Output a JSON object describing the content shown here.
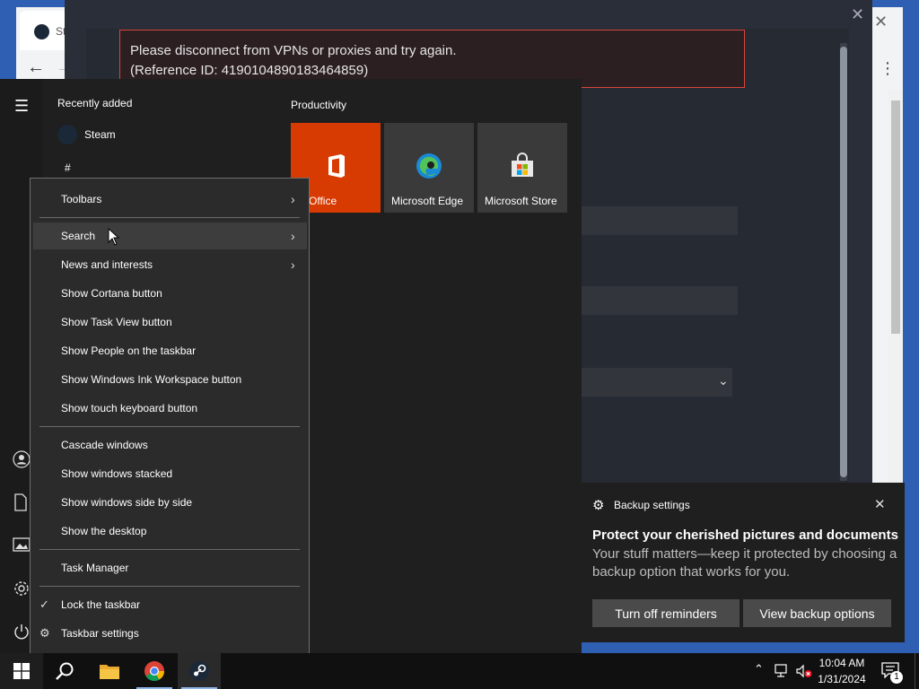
{
  "chrome": {
    "tab_label": "St",
    "close_glyph": "✕",
    "back_glyph": "←",
    "forward_glyph": "→",
    "menu_glyph": "⋮"
  },
  "steam_dialog": {
    "close_glyph": "✕",
    "error_line1": "Please disconnect from VPNs or proxies and try again.",
    "error_line2": "(Reference ID: 4190104890183464859)",
    "select_chevron": "⌄"
  },
  "start_menu": {
    "hamburger_glyph": "☰",
    "recently_added_label": "Recently added",
    "steam_app_label": "Steam",
    "hash_header": "#",
    "group_label": "Productivity",
    "tiles": {
      "office_label": "Office",
      "edge_label": "Microsoft Edge",
      "store_label": "Microsoft Store"
    }
  },
  "context_menu": {
    "items": [
      {
        "label": "Toolbars"
      },
      {
        "label": "Search"
      },
      {
        "label": "News and interests"
      },
      {
        "label": "Show Cortana button"
      },
      {
        "label": "Show Task View button"
      },
      {
        "label": "Show People on the taskbar"
      },
      {
        "label": "Show Windows Ink Workspace button"
      },
      {
        "label": "Show touch keyboard button"
      },
      {
        "label": "Cascade windows"
      },
      {
        "label": "Show windows stacked"
      },
      {
        "label": "Show windows side by side"
      },
      {
        "label": "Show the desktop"
      },
      {
        "label": "Task Manager"
      },
      {
        "label": "Lock the taskbar"
      },
      {
        "label": "Taskbar settings"
      }
    ],
    "submenu_glyph": "›",
    "check_glyph": "✓",
    "gear_glyph": "⚙"
  },
  "toast": {
    "app_name": "Backup settings",
    "title": "Protect your cherished pictures and documents",
    "body": "Your stuff matters—keep it protected by choosing a backup option that works for you.",
    "button_off": "Turn off reminders",
    "button_view": "View backup options",
    "close_glyph": "✕",
    "gear_glyph": "⚙"
  },
  "taskbar": {
    "tray_chevron": "⌃",
    "time": "10:04 AM",
    "date": "1/31/2024",
    "notification_count": "1"
  },
  "colors": {
    "desktop": "#2f5fb3",
    "office_orange": "#d83b01",
    "error_border": "#d9453a",
    "taskbar": "#101010"
  }
}
